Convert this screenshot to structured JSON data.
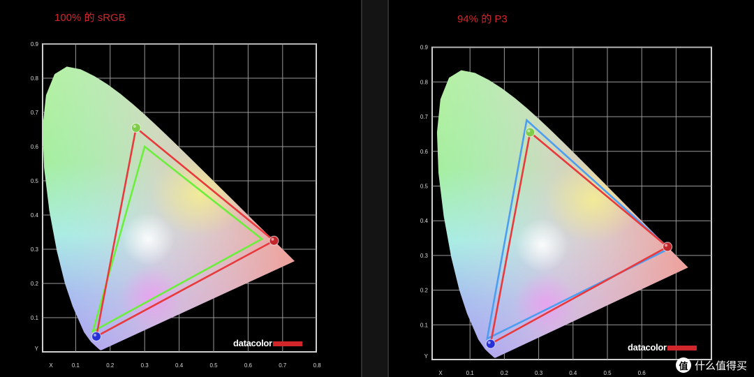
{
  "panels": [
    {
      "title": "100% 的 sRGB",
      "logo": "datacolor",
      "x_axis_label": "X",
      "y_axis_label": "Y",
      "x_ticks": [
        "0.1",
        "0.2",
        "0.3",
        "0.4",
        "0.5",
        "0.6",
        "0.7",
        "0.8"
      ],
      "y_ticks": [
        "0.1",
        "0.2",
        "0.3",
        "0.4",
        "0.5",
        "0.6",
        "0.7",
        "0.8",
        "0.9"
      ]
    },
    {
      "title": "94% 的 P3",
      "logo": "datacolor",
      "x_axis_label": "X",
      "y_axis_label": "Y",
      "x_ticks": [
        "0.1",
        "0.2",
        "0.3",
        "0.4",
        "0.5",
        "0.6"
      ],
      "y_ticks": [
        "0.1",
        "0.2",
        "0.3",
        "0.4",
        "0.5",
        "0.6",
        "0.7",
        "0.8",
        "0.9"
      ]
    }
  ],
  "watermark": {
    "badge": "值",
    "text": "什么值得买"
  },
  "chart_data": [
    {
      "type": "scatter",
      "title": "100% 的 sRGB",
      "xlabel": "X",
      "ylabel": "Y",
      "xlim": [
        0,
        0.8
      ],
      "ylim": [
        0,
        0.9
      ],
      "grid": true,
      "series": [
        {
          "color": "#e8393c",
          "values": [
            [
              0.675,
              0.325
            ],
            [
              0.275,
              0.655
            ],
            [
              0.16,
              0.045
            ]
          ]
        },
        {
          "color": "#6cef3c",
          "values": [
            [
              0.64,
              0.33
            ],
            [
              0.3,
              0.6
            ],
            [
              0.15,
              0.06
            ]
          ]
        }
      ]
    },
    {
      "type": "scatter",
      "title": "94% 的 P3",
      "xlabel": "X",
      "ylabel": "Y",
      "xlim": [
        0,
        0.7
      ],
      "ylim": [
        0,
        0.9
      ],
      "grid": true,
      "series": [
        {
          "color": "#e8393c",
          "values": [
            [
              0.675,
              0.325
            ],
            [
              0.275,
              0.655
            ],
            [
              0.16,
              0.045
            ]
          ]
        },
        {
          "color": "#4d9df0",
          "values": [
            [
              0.68,
              0.32
            ],
            [
              0.265,
              0.69
            ],
            [
              0.15,
              0.06
            ]
          ]
        }
      ]
    }
  ]
}
